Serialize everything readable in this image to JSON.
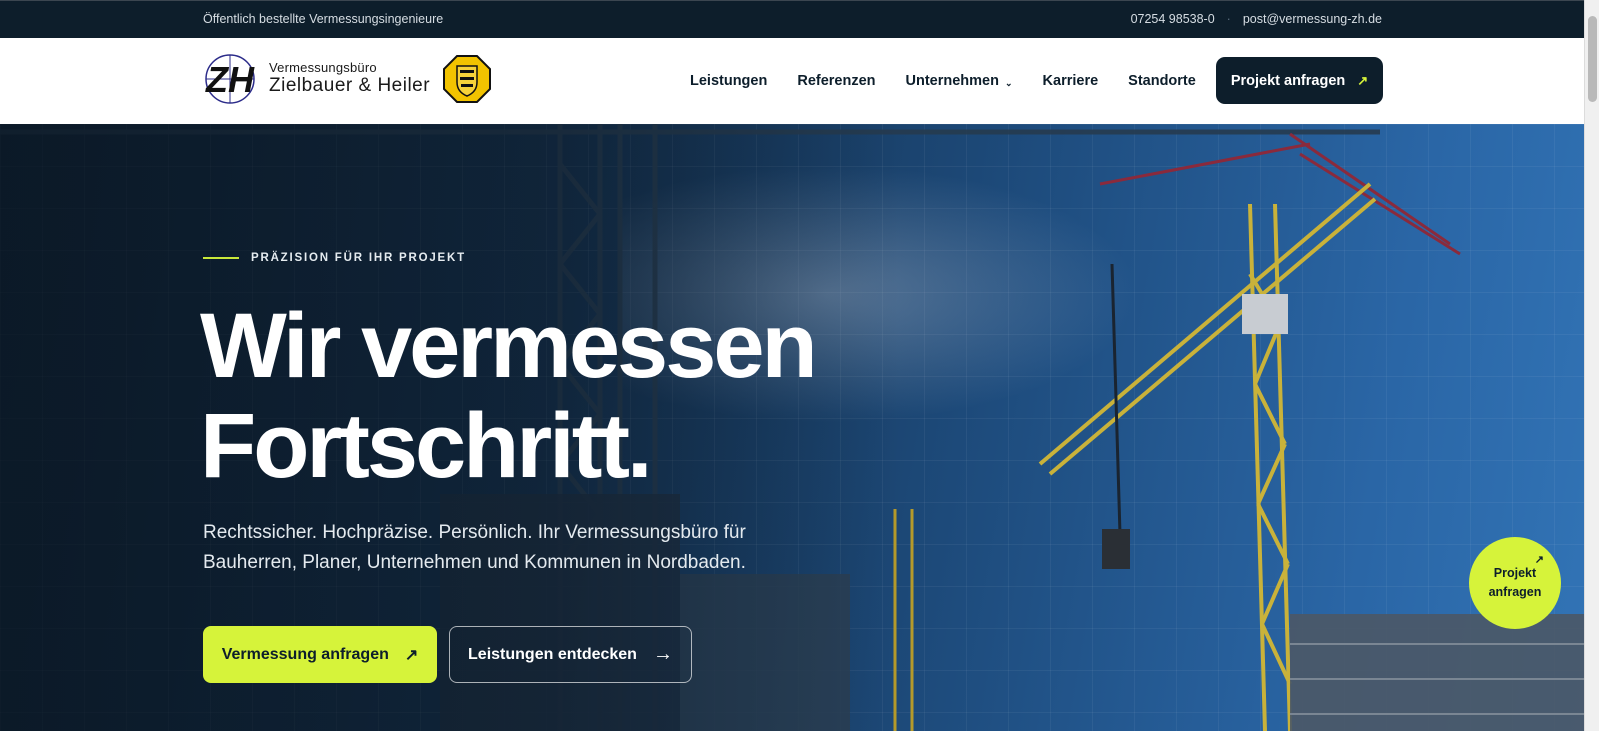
{
  "topbar": {
    "tagline": "Öffentlich bestellte Vermessungsingenieure",
    "phone": "07254 98538-0",
    "separator": "·",
    "email": "post@vermessung-zh.de"
  },
  "logo": {
    "mark": "ZH",
    "small": "Vermessungsbüro",
    "big": "Zielbauer & Heiler"
  },
  "nav": {
    "items": [
      "Leistungen",
      "Referenzen",
      "Unternehmen",
      "Karriere",
      "Standorte"
    ],
    "dropdown_icon": "chevron-down-icon",
    "cta": "Projekt anfragen",
    "cta_arrow": "↗"
  },
  "hero": {
    "eyebrow": "PRÄZISION FÜR IHR PROJEKT",
    "headline_line1": "Wir vermessen",
    "headline_line2": "Fortschritt.",
    "sub": "Rechtssicher. Hochpräzise. Persönlich. Ihr Vermessungsbüro für Bauherren, Planer, Unternehmen und Kommunen in Nordbaden.",
    "primary_button": "Vermessung anfragen",
    "primary_arrow": "↗",
    "secondary_button": "Leistungen entdecken",
    "secondary_arrow": "→"
  },
  "float_cta": {
    "line1": "Projekt",
    "line2": "anfragen",
    "arrow": "↗"
  },
  "colors": {
    "navy": "#0d1e2b",
    "accent": "#d6f33a",
    "sky": "#2a66a6"
  }
}
